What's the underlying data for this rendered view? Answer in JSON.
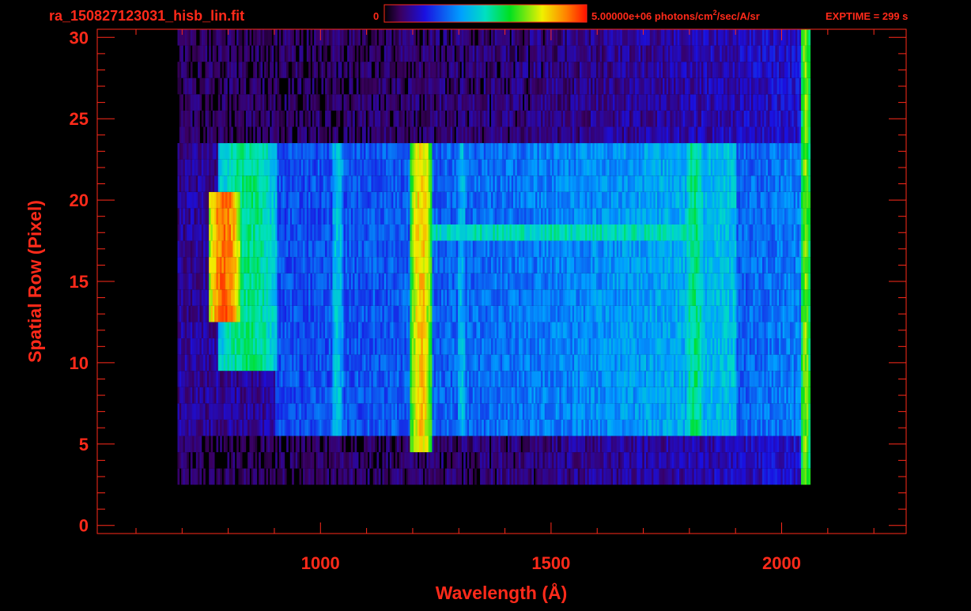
{
  "chart_data": {
    "type": "heatmap",
    "title": "ra_150827123031_hisb_lin.fit",
    "colorbar": {
      "min_label": "0",
      "max_label": "5.00000e+06 photons/cm",
      "max_label_sup": "2",
      "max_label_tail": "/sec/A/sr",
      "min": 0,
      "max": 5000000,
      "colormap": "rainbow"
    },
    "exptime_label": "EXPTIME = 299 s",
    "xlabel": "Wavelength (Å)",
    "ylabel": "Spatial Row (Pixel)",
    "xlim": [
      516,
      2270
    ],
    "ylim": [
      -0.5,
      30.5
    ],
    "x_ticks": [
      1000,
      1500,
      2000
    ],
    "y_ticks": [
      0,
      5,
      10,
      15,
      20,
      25,
      30
    ],
    "x_minor_step": 100,
    "y_minor_step": 1,
    "grid": false,
    "data_extent": {
      "x_start": 690,
      "x_end": 2060,
      "row_start": 3,
      "row_end": 30
    },
    "features": [
      {
        "name": "emission-band-near-790",
        "center": 790,
        "width": 70,
        "rows": [
          13,
          20
        ],
        "value": 0.92
      },
      {
        "name": "emission-arc-near-830",
        "center": 840,
        "width": 130,
        "rows": [
          10,
          23
        ],
        "value": 0.55
      },
      {
        "name": "emission-line-near-1216",
        "center": 1216,
        "width": 45,
        "rows": [
          5,
          23
        ],
        "value": 0.82
      },
      {
        "name": "emission-line-near-1035",
        "center": 1035,
        "width": 25,
        "rows": [
          6,
          23
        ],
        "value": 0.45
      },
      {
        "name": "emission-line-near-1304",
        "center": 1304,
        "width": 20,
        "rows": [
          6,
          23
        ],
        "value": 0.42
      },
      {
        "name": "emission-line-near-1810",
        "center": 1810,
        "width": 40,
        "rows": [
          6,
          23
        ],
        "value": 0.55
      },
      {
        "name": "emission-edge-near-2050",
        "center": 2050,
        "width": 20,
        "rows": [
          3,
          30
        ],
        "value": 0.7
      },
      {
        "name": "horizontal-band-row-18",
        "x_range": [
          1210,
          1800
        ],
        "row": 18,
        "value": 0.5
      }
    ]
  }
}
